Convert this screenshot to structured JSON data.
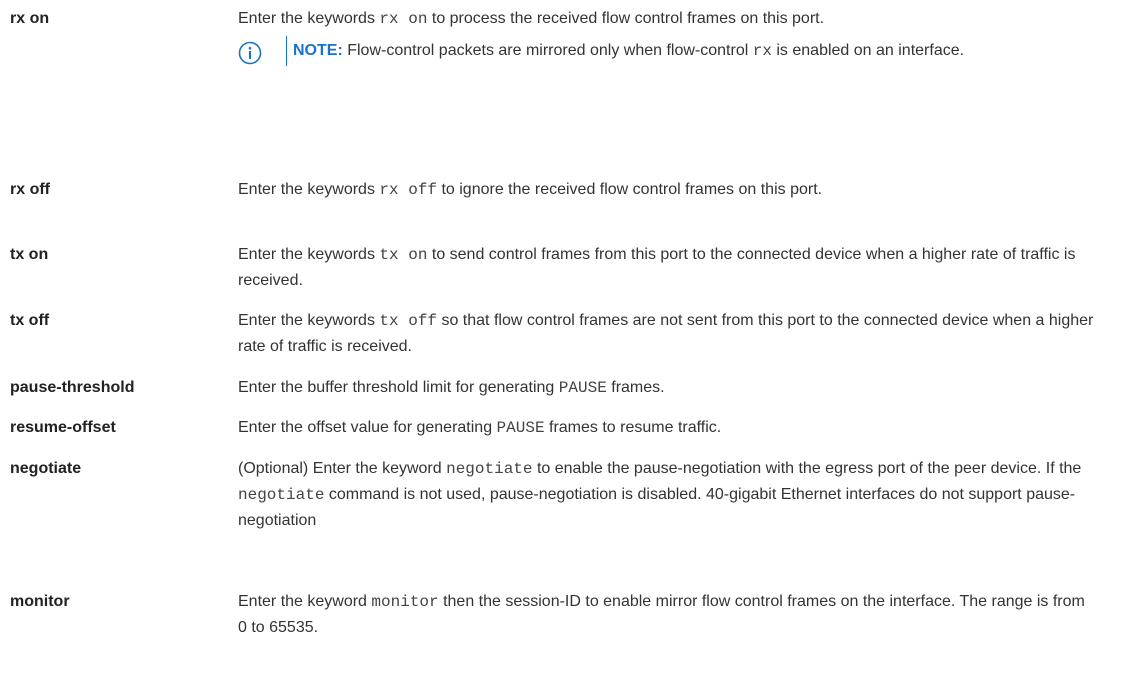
{
  "rows": [
    {
      "term": "rx on",
      "parts": [
        "Enter the keywords ",
        "rx on",
        " to process the received flow control frames on this port."
      ],
      "note": {
        "label": "NOTE:",
        "parts": [
          " Flow-control packets are mirrored only when flow-control ",
          "rx",
          " is enabled on an interface."
        ]
      }
    },
    {
      "term": "rx off",
      "parts": [
        "Enter the keywords ",
        "rx off",
        " to ignore the received flow control frames on this port."
      ]
    },
    {
      "term": "tx on",
      "parts": [
        "Enter the keywords ",
        "tx on",
        " to send control frames from this port to the connected device when a higher rate of traffic is received."
      ]
    },
    {
      "term": "tx off",
      "parts": [
        "Enter the keywords ",
        "tx off",
        " so that flow control frames are not sent from this port to the connected device when a higher rate of traffic is received."
      ]
    },
    {
      "term": "pause-threshold",
      "parts": [
        "Enter the buffer threshold limit for generating ",
        "PAUSE",
        " frames."
      ]
    },
    {
      "term": "resume-offset",
      "parts": [
        "Enter the offset value for generating ",
        "PAUSE",
        " frames to resume traffic."
      ]
    },
    {
      "term": "negotiate",
      "parts": [
        "(Optional) Enter the keyword ",
        "negotiate",
        " to enable the pause-negotiation with the egress port of the peer device. If the ",
        "negotiate",
        " command is not used, pause-negotiation is disabled. 40-gigabit Ethernet interfaces do not support pause-negotiation"
      ]
    },
    {
      "term": "monitor",
      "parts": [
        "Enter the keyword ",
        "monitor",
        " then the session-ID to enable mirror flow control frames on the interface. The range is from 0 to 65535."
      ]
    }
  ],
  "colors": {
    "note_accent": "#1a73c9"
  },
  "icons": {
    "note": "info-circle-icon"
  }
}
